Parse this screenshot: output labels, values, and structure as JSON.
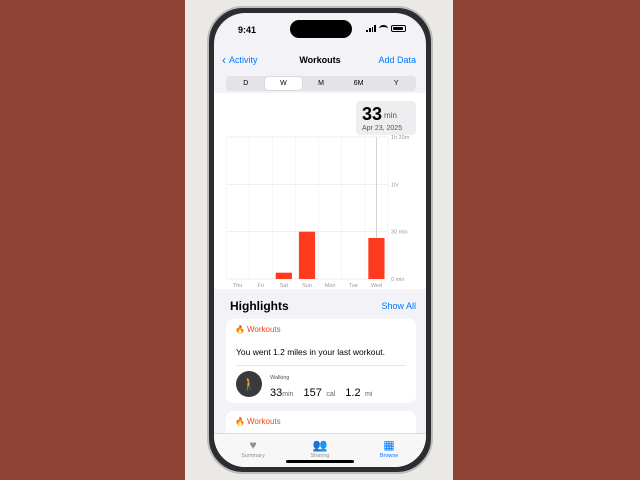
{
  "status_bar": {
    "time": "9:41"
  },
  "nav": {
    "back_label": "Activity",
    "title": "Workouts",
    "add_label": "Add Data"
  },
  "segments": [
    "D",
    "W",
    "M",
    "6M",
    "Y"
  ],
  "selected_segment": "W",
  "callout": {
    "value": "33",
    "unit": "min",
    "date": "Apr 23, 2025"
  },
  "chart_data": {
    "type": "bar",
    "categories": [
      "Thu",
      "Fri",
      "Sat",
      "Sun",
      "Mon",
      "Tue",
      "Wed"
    ],
    "values": [
      0,
      0,
      4,
      30,
      0,
      0,
      26
    ],
    "selected_index": 6,
    "y_ticks": [
      {
        "value": 0,
        "label": "0 min"
      },
      {
        "value": 30,
        "label": "30 min"
      },
      {
        "value": 60,
        "label": "1hr"
      },
      {
        "value": 90,
        "label": "1h 30m"
      }
    ],
    "ylim": [
      0,
      90
    ],
    "bar_color": "#ff3b1f",
    "grid": true
  },
  "highlights": {
    "title": "Highlights",
    "show_all": "Show All",
    "card1": {
      "category": "Workouts",
      "headline": "You went 1.2 miles in your last workout.",
      "activity": "Walking",
      "stats": [
        {
          "value": "33",
          "unit": "min"
        },
        {
          "value": "157",
          "unit": "cal"
        },
        {
          "value": "1.2",
          "unit": "mi"
        }
      ]
    },
    "card2": {
      "category": "Workouts"
    }
  },
  "tabbar": {
    "items": [
      {
        "label": "Summary",
        "icon": "heart-icon"
      },
      {
        "label": "Sharing",
        "icon": "people-icon"
      },
      {
        "label": "Browse",
        "icon": "grid-icon"
      }
    ],
    "active": "Browse"
  },
  "colors": {
    "accent": "#007aff",
    "workout_orange": "#e64a19",
    "background": "#8f4337"
  }
}
